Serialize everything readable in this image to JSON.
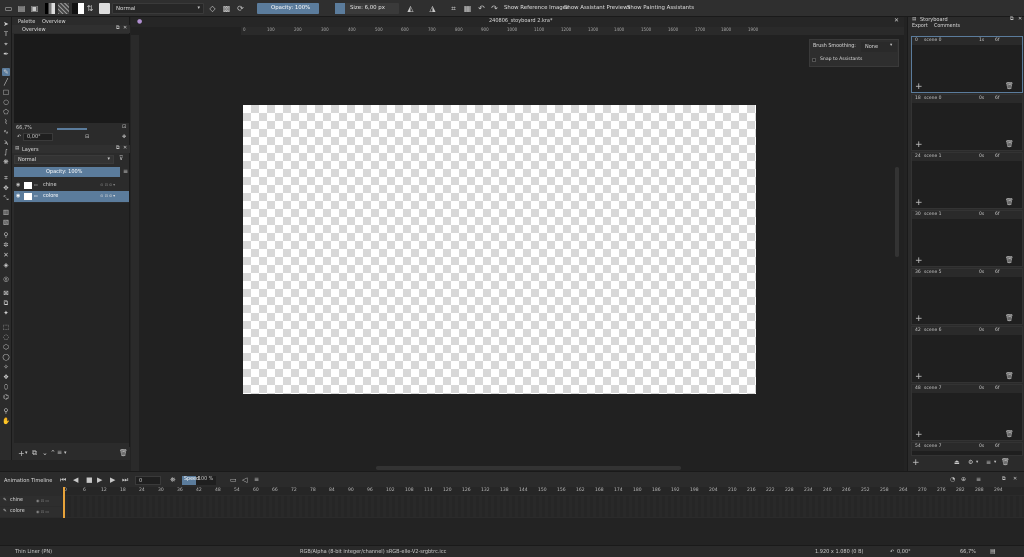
{
  "toolbar": {
    "blend_mode": "Normal",
    "opacity": "Opacity: 100%",
    "size": "Size: 6,00 px",
    "show_reference_images": "Show Reference Images",
    "show_assistant_previews": "Show Assistant Previews",
    "show_painting_assistants": "Show Painting Assistants"
  },
  "left_dock": {
    "tabs": [
      "Palette",
      "Overview"
    ],
    "overview_title": "Overview",
    "zoom": "66,7%",
    "rotation": "0,00°",
    "layers_title": "Layers",
    "layer_blend": "Normal",
    "layer_opacity": "Opacity: 100%",
    "layers": [
      {
        "name": "chine",
        "selected": false
      },
      {
        "name": "colore",
        "selected": true
      }
    ]
  },
  "canvas": {
    "doc_title": "240806_stoyboard 2.kra*",
    "ruler_ticks": [
      "0",
      "100",
      "200",
      "300",
      "400",
      "500",
      "600",
      "700",
      "800",
      "900",
      "1000",
      "1100",
      "1200",
      "1300",
      "1400",
      "1500",
      "1600",
      "1700",
      "1800",
      "1900"
    ],
    "brush_smoothing_label": "Brush Smoothing:",
    "brush_smoothing_value": "None",
    "snap_to_assistants": "Snap to Assistants"
  },
  "storyboard": {
    "title": "Storyboard",
    "export": "Export",
    "comments": "Comments",
    "scenes": [
      {
        "frame": "0",
        "name": "scene 0",
        "time": "1s",
        "frames": "6f"
      },
      {
        "frame": "18",
        "name": "scene 0",
        "time": "0s",
        "frames": "6f"
      },
      {
        "frame": "24",
        "name": "scene 1",
        "time": "0s",
        "frames": "6f"
      },
      {
        "frame": "30",
        "name": "scene 1",
        "time": "0s",
        "frames": "6f"
      },
      {
        "frame": "36",
        "name": "scene 5",
        "time": "0s",
        "frames": "6f"
      },
      {
        "frame": "42",
        "name": "scene 6",
        "time": "0s",
        "frames": "6f"
      },
      {
        "frame": "48",
        "name": "scene 7",
        "time": "0s",
        "frames": "6f"
      },
      {
        "frame": "54",
        "name": "scene 7",
        "time": "0s",
        "frames": "6f"
      }
    ]
  },
  "timeline": {
    "title": "Animation Timeline",
    "current_frame": "0",
    "speed_label": "Speed:",
    "speed_value": "100 %",
    "frame_ticks": [
      "0",
      "6",
      "12",
      "18",
      "24",
      "30",
      "36",
      "42",
      "48",
      "54",
      "60",
      "66",
      "72",
      "78",
      "84",
      "90",
      "96",
      "102",
      "108",
      "114",
      "120",
      "126",
      "132",
      "138",
      "144",
      "150",
      "156",
      "162",
      "168",
      "174",
      "180",
      "186",
      "192",
      "198",
      "204",
      "210",
      "216",
      "222",
      "228",
      "234",
      "240",
      "246",
      "252",
      "258",
      "264",
      "270",
      "276",
      "282",
      "288",
      "294"
    ],
    "layers": [
      "chine",
      "colore"
    ]
  },
  "status": {
    "brush": "Thin Liner (PN)",
    "color_info": "RGB/Alpha (8-bit integer/channel)  sRGB-elle-V2-srgbtrc.icc",
    "size_info": "1.920 x 1.080 (0 B)",
    "rotation": "0,00°",
    "zoom": "66,7%"
  }
}
